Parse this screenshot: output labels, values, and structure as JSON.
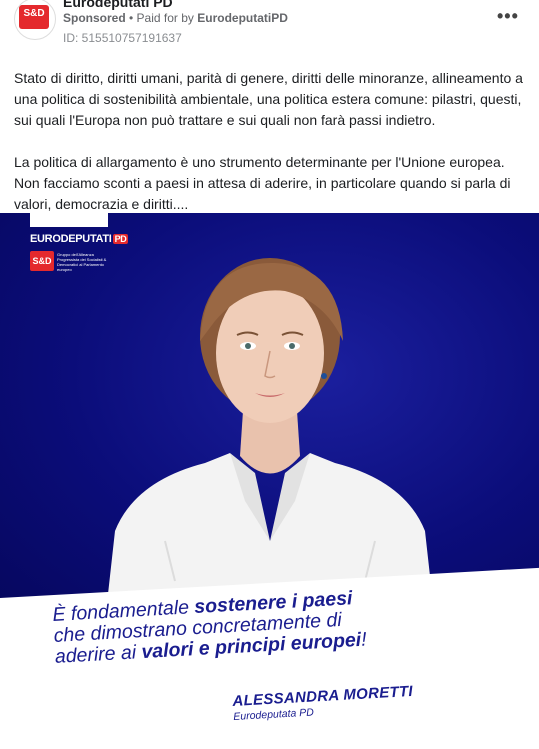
{
  "post": {
    "page_name": "Eurodeputati PD",
    "sponsored": "Sponsored",
    "separator": " • ",
    "paid_for_prefix": "Paid for by ",
    "payer": "EurodeputatiPD",
    "ad_id": "ID: 515510757191637",
    "more_icon": "more-horizontal-icon",
    "avatar_label": "S&D"
  },
  "body": {
    "paragraph1": "Stato di diritto, diritti umani, parità di genere, diritti delle minoranze, allineamento a una politica di sostenibilità ambientale, una politica estera comune: pilastri, questi, sui quali l'Europa non può trattare e sui quali non farà passi indietro.",
    "paragraph2": "La politica di allargamento è uno strumento determinante per l'Unione europea. Non facciamo sconti a paesi in attesa di aderire, in particolare quando si parla di valori, democrazia e diritti...."
  },
  "creative": {
    "logo_euro": "EURODEPUTATI",
    "logo_pd": "PD",
    "logo_sd": "S&D",
    "logo_sd_text": "Gruppo dell'Alleanza Progressista dei Socialisti & Democratici al Parlamento europeo",
    "quote_line1_a": "È fondamentale ",
    "quote_line1_b": "sostenere i paesi",
    "quote_line2": "che dimostrano concretamente di",
    "quote_line3_a": "aderire ai ",
    "quote_line3_b": "valori e principi europei",
    "quote_line3_c": "!",
    "signer_name": "ALESSANDRA MORETTI",
    "signer_role": "Eurodeputata PD",
    "colors": {
      "blue": "#0d0f86",
      "accent": "#1a1d8f",
      "red": "#e4292d"
    }
  }
}
